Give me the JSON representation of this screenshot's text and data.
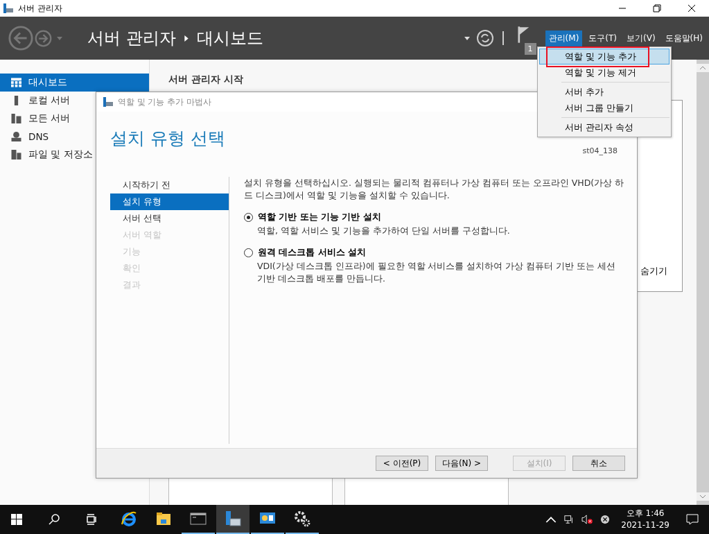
{
  "window": {
    "title": "서버 관리자"
  },
  "header": {
    "breadcrumb": [
      "서버 관리자",
      "대시보드"
    ],
    "flag_count": "1",
    "menus": [
      {
        "label": "관리(M)",
        "selected": true
      },
      {
        "label": "도구(T)",
        "selected": false
      },
      {
        "label": "보기(V)",
        "selected": false
      },
      {
        "label": "도움말(H)",
        "selected": false
      }
    ]
  },
  "sidebar": {
    "items": [
      {
        "label": "대시보드",
        "kind": "grid",
        "selected": true
      },
      {
        "label": "로컬 서버",
        "kind": "server",
        "selected": false
      },
      {
        "label": "모든 서버",
        "kind": "servers",
        "selected": false
      },
      {
        "label": "DNS",
        "kind": "dns",
        "selected": false
      },
      {
        "label": "파일 및 저장소",
        "kind": "files",
        "selected": false
      }
    ]
  },
  "content": {
    "title": "서버 관리자 시작",
    "hide_link": "숨기기"
  },
  "manage_menu": {
    "groups": [
      [
        {
          "label": "역할 및 기능 추가",
          "selected": true,
          "annotated": true
        },
        {
          "label": "역할 및 기능 제거",
          "selected": false,
          "annotated": false
        }
      ],
      [
        {
          "label": "서버 추가",
          "selected": false,
          "annotated": false
        },
        {
          "label": "서버 그룹 만들기",
          "selected": false,
          "annotated": false
        }
      ],
      [
        {
          "label": "서버 관리자 속성",
          "selected": false,
          "annotated": false
        }
      ]
    ]
  },
  "wizard": {
    "title": "역할 및 기능 추가 마법사",
    "heading": "설치 유형 선택",
    "target_server": "st04_138",
    "steps": [
      {
        "label": "시작하기 전",
        "selected": false,
        "disabled": false
      },
      {
        "label": "설치 유형",
        "selected": true,
        "disabled": false
      },
      {
        "label": "서버 선택",
        "selected": false,
        "disabled": false
      },
      {
        "label": "서버 역할",
        "selected": false,
        "disabled": true
      },
      {
        "label": "기능",
        "selected": false,
        "disabled": true
      },
      {
        "label": "확인",
        "selected": false,
        "disabled": true
      },
      {
        "label": "결과",
        "selected": false,
        "disabled": true
      }
    ],
    "intro": "설치 유형을 선택하십시오. 실행되는 물리적 컴퓨터나 가상 컴퓨터 또는 오프라인 VHD(가상 하드 디스크)에서 역할 및 기능을 설치할 수 있습니다.",
    "options": [
      {
        "label": "역할 기반 또는 기능 기반 설치",
        "description": "역할, 역할 서비스 및 기능을 추가하여 단일 서버를 구성합니다.",
        "selected": true
      },
      {
        "label": "원격 데스크톱 서비스 설치",
        "description": "VDI(가상 데스크톱 인프라)에 필요한 역할 서비스를 설치하여 가상 컴퓨터 기반 또는 세션 기반 데스크톱 배포를 만듭니다.",
        "selected": false
      }
    ],
    "buttons": [
      {
        "label": "< 이전(P)",
        "disabled": false
      },
      {
        "label": "다음(N) >",
        "disabled": false
      },
      {
        "label": "설치(I)",
        "disabled": true
      },
      {
        "label": "취소",
        "disabled": false
      }
    ]
  },
  "taskbar": {
    "apps": [
      {
        "kind": "ie",
        "running": false,
        "selected": false
      },
      {
        "kind": "explorer",
        "running": false,
        "selected": false
      },
      {
        "kind": "cmd",
        "running": true,
        "selected": false
      },
      {
        "kind": "servermanager",
        "running": true,
        "selected": true
      },
      {
        "kind": "monitor",
        "running": true,
        "selected": false
      },
      {
        "kind": "gear",
        "running": true,
        "selected": false
      }
    ],
    "time": "오후 1:46",
    "date": "2021-11-29"
  }
}
